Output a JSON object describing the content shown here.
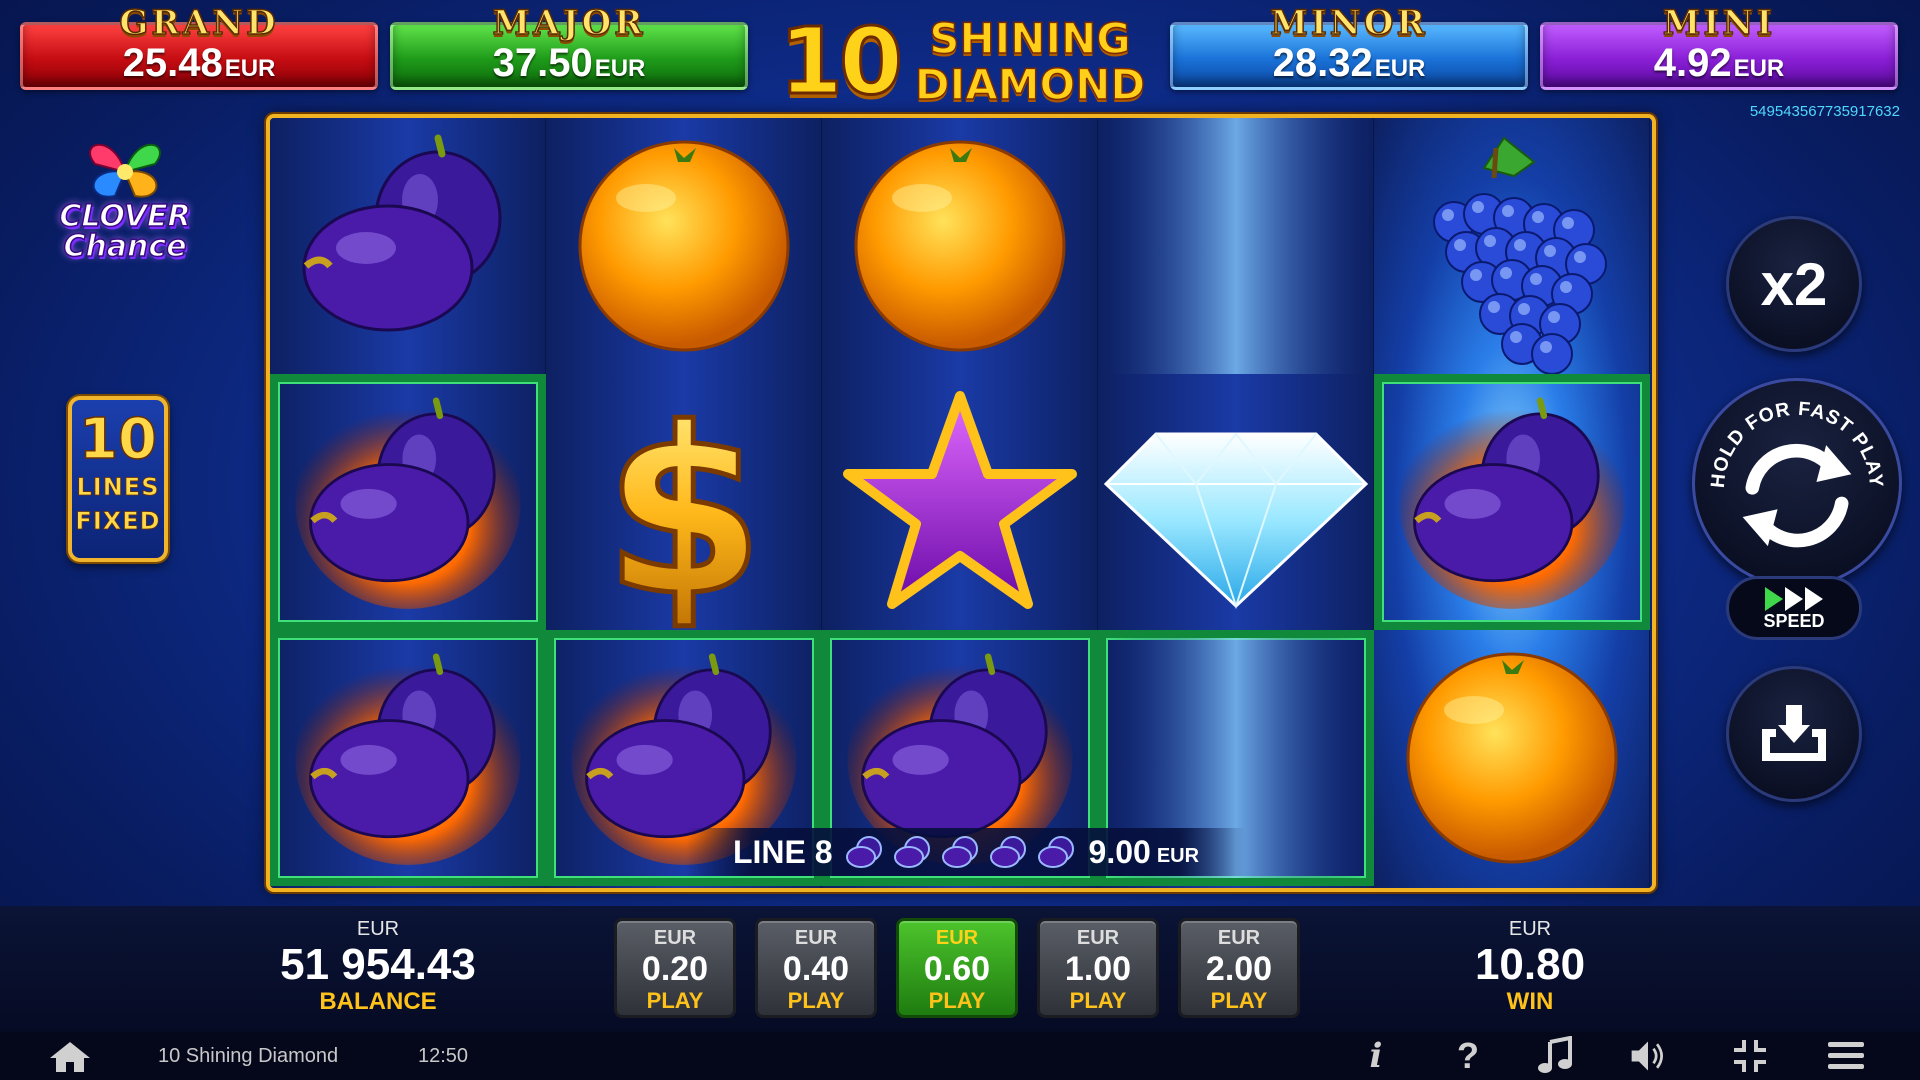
{
  "jackpots": [
    {
      "name": "GRAND",
      "value": "25.48",
      "currency": "EUR",
      "color": "#c50d12"
    },
    {
      "name": "MAJOR",
      "value": "37.50",
      "currency": "EUR",
      "color": "#1f9b1a"
    },
    {
      "name": "MINOR",
      "value": "28.32",
      "currency": "EUR",
      "color": "#1a72d8"
    },
    {
      "name": "MINI",
      "value": "4.92",
      "currency": "EUR",
      "color": "#8a1fd6"
    }
  ],
  "logo": {
    "number": "10",
    "line1": "SHINING",
    "line2": "DIAMOND"
  },
  "ticket_id": "5495435677359176​32",
  "clover_logo": {
    "line1": "CLOVER",
    "line2": "Chance"
  },
  "lines_badge": {
    "number": "10",
    "word1": "LINES",
    "word2": "FIXED"
  },
  "reels": [
    [
      "plum",
      "plum-fire",
      "plum-fire"
    ],
    [
      "orange",
      "dollar",
      "plum-fire"
    ],
    [
      "orange",
      "star",
      "plum-fire"
    ],
    [
      "light",
      "diamond",
      "light"
    ],
    [
      "grapes",
      "plum-fire",
      "orange"
    ]
  ],
  "winning_cells": [
    [
      0,
      1
    ],
    [
      0,
      2
    ],
    [
      1,
      2
    ],
    [
      2,
      2
    ],
    [
      3,
      2
    ],
    [
      4,
      1
    ]
  ],
  "line_win": {
    "label": "LINE 8",
    "symbol_count": 5,
    "amount": "9.00",
    "currency": "EUR"
  },
  "controls": {
    "multiplier_label": "x2",
    "spin_hint": "HOLD FOR FAST PLAY",
    "speed_label": "SPEED"
  },
  "balance": {
    "currency": "EUR",
    "value": "51 954.43",
    "label": "BALANCE"
  },
  "win": {
    "currency": "EUR",
    "value": "10.80",
    "label": "WIN"
  },
  "bets": [
    {
      "currency": "EUR",
      "value": "0.20",
      "label": "PLAY",
      "active": false
    },
    {
      "currency": "EUR",
      "value": "0.40",
      "label": "PLAY",
      "active": false
    },
    {
      "currency": "EUR",
      "value": "0.60",
      "label": "PLAY",
      "active": true
    },
    {
      "currency": "EUR",
      "value": "1.00",
      "label": "PLAY",
      "active": false
    },
    {
      "currency": "EUR",
      "value": "2.00",
      "label": "PLAY",
      "active": false
    }
  ],
  "footer": {
    "title": "10 Shining Diamond",
    "time": "12:50",
    "info_glyph": "i",
    "help_glyph": "?",
    "icons": [
      "home-icon",
      "info-icon",
      "help-icon",
      "music-icon",
      "sound-icon",
      "fullscreen-icon",
      "menu-icon"
    ]
  }
}
